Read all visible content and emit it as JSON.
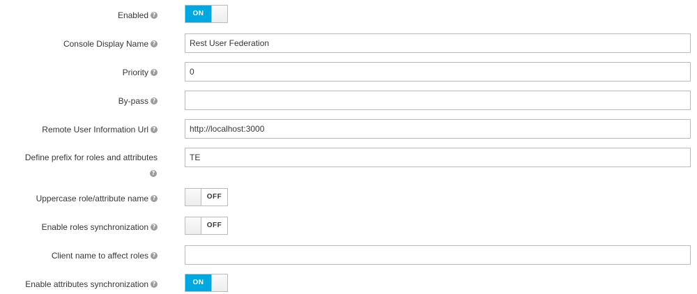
{
  "fields": {
    "enabled": {
      "label": "Enabled",
      "state": "ON"
    },
    "console_display_name": {
      "label": "Console Display Name",
      "value": "Rest User Federation"
    },
    "priority": {
      "label": "Priority",
      "value": "0"
    },
    "by_pass": {
      "label": "By-pass",
      "value": ""
    },
    "remote_user_info_url": {
      "label": "Remote User Information Url",
      "value": "http://localhost:3000"
    },
    "define_prefix": {
      "label": "Define prefix for roles and attributes",
      "value": "TE"
    },
    "uppercase_name": {
      "label": "Uppercase role/attribute name",
      "state": "OFF"
    },
    "enable_roles_sync": {
      "label": "Enable roles synchronization",
      "state": "OFF"
    },
    "client_name_roles": {
      "label": "Client name to affect roles",
      "value": ""
    },
    "enable_attributes_sync": {
      "label": "Enable attributes synchronization",
      "state": "ON"
    }
  },
  "help_icon": "question-circle-icon",
  "colors": {
    "switch_on": "#00a8e1",
    "border": "#bbbbbb",
    "text": "#363636",
    "help_icon": "#9c9c9c"
  }
}
